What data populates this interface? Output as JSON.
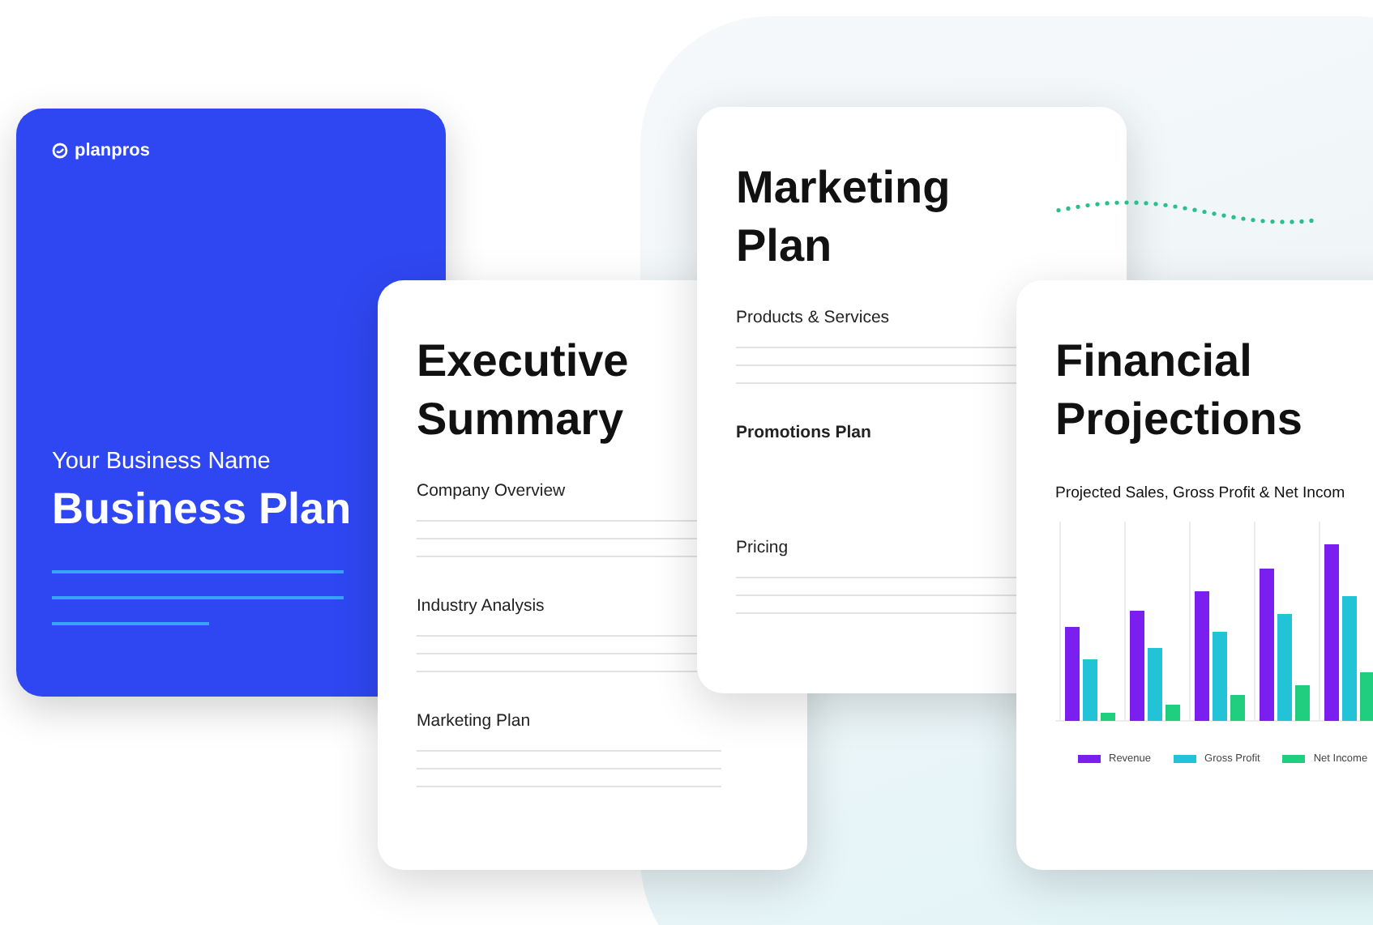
{
  "cover": {
    "brand": "planpros",
    "subtitle": "Your Business Name",
    "title": "Business Plan"
  },
  "documents": [
    {
      "title_lines": [
        "Executive",
        "Summary"
      ],
      "sections": [
        {
          "label": "Company Overview",
          "kind": "lined",
          "bold": false
        },
        {
          "label": "Industry Analysis",
          "kind": "lined",
          "bold": false
        },
        {
          "label": "Marketing Plan",
          "kind": "lined",
          "bold": false
        }
      ]
    },
    {
      "title_lines": [
        "Marketing",
        "Plan"
      ],
      "sections": [
        {
          "label": "Products & Services",
          "kind": "lined",
          "bold": false
        },
        {
          "label": "Promotions Plan",
          "kind": "plain",
          "bold": true
        },
        {
          "label": "Pricing",
          "kind": "lined",
          "bold": false
        }
      ]
    }
  ],
  "financial": {
    "title_lines": [
      "Financial",
      "Projections"
    ],
    "chart_title": "Projected Sales, Gross Profit & Net Incom",
    "legend": [
      {
        "label": "Revenue",
        "color": "#7b1ff0"
      },
      {
        "label": "Gross Profit",
        "color": "#22c3d6"
      },
      {
        "label": "Net Income",
        "color": "#1fcf7f"
      }
    ]
  }
}
